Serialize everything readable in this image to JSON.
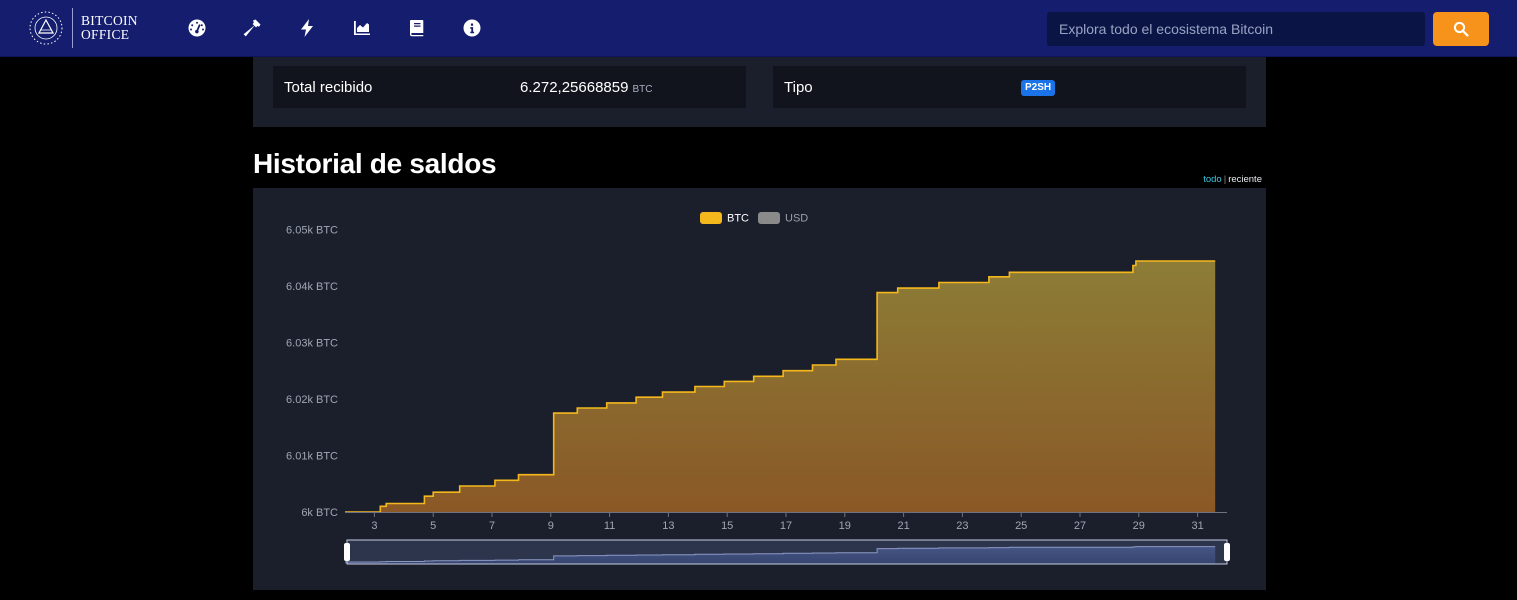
{
  "brand": {
    "line1": "BITCOIN",
    "line2": "OFFICE"
  },
  "nav": {
    "icons": [
      "dashboard-icon",
      "hammer-icon",
      "lightning-icon",
      "chart-icon",
      "book-icon",
      "info-icon"
    ]
  },
  "search": {
    "placeholder": "Explora todo el ecosistema Bitcoin"
  },
  "address_info": {
    "total_received_label": "Total recibido",
    "total_received_value": "6.272,25668859",
    "total_received_unit": "BTC",
    "type_label": "Tipo",
    "type_value": "P2SH"
  },
  "balance_history": {
    "title": "Historial de saldos",
    "range_all": "todo",
    "range_separator": "|",
    "range_recent": "reciente"
  },
  "colors": {
    "navbar": "#141d6e",
    "accent": "#f7931a",
    "panel": "#1b1f2c",
    "btc_line": "#f5b81c",
    "badge": "#1a73e8"
  },
  "chart_data": {
    "type": "area",
    "legend": [
      {
        "name": "BTC",
        "color": "#f5b81c",
        "active": true
      },
      {
        "name": "USD",
        "color": "#8a8a8a",
        "active": false
      }
    ],
    "legend_position": "top-center",
    "y_ticks": [
      {
        "value": 6000,
        "label": "6k BTC"
      },
      {
        "value": 6010,
        "label": "6.01k BTC"
      },
      {
        "value": 6020,
        "label": "6.02k BTC"
      },
      {
        "value": 6030,
        "label": "6.03k BTC"
      },
      {
        "value": 6040,
        "label": "6.04k BTC"
      },
      {
        "value": 6050,
        "label": "6.05k BTC"
      }
    ],
    "x_ticks": [
      3,
      5,
      7,
      9,
      11,
      13,
      15,
      17,
      19,
      21,
      23,
      25,
      27,
      29,
      31
    ],
    "xlim": [
      2,
      32
    ],
    "ylim": [
      6000,
      6052
    ],
    "grid": false,
    "step": true,
    "series": [
      {
        "name": "BTC",
        "points": [
          [
            2.0,
            6000.0
          ],
          [
            3.2,
            6000.0
          ],
          [
            3.2,
            6001.0
          ],
          [
            3.4,
            6001.0
          ],
          [
            3.4,
            6001.5
          ],
          [
            4.7,
            6001.5
          ],
          [
            4.7,
            6002.8
          ],
          [
            5.0,
            6002.8
          ],
          [
            5.0,
            6003.5
          ],
          [
            5.9,
            6003.5
          ],
          [
            5.9,
            6004.6
          ],
          [
            7.1,
            6004.6
          ],
          [
            7.1,
            6005.6
          ],
          [
            7.9,
            6005.6
          ],
          [
            7.9,
            6006.6
          ],
          [
            9.1,
            6006.6
          ],
          [
            9.1,
            6017.5
          ],
          [
            9.9,
            6017.5
          ],
          [
            9.9,
            6018.4
          ],
          [
            10.9,
            6018.4
          ],
          [
            10.9,
            6019.3
          ],
          [
            11.9,
            6019.3
          ],
          [
            11.9,
            6020.3
          ],
          [
            12.8,
            6020.3
          ],
          [
            12.8,
            6021.2
          ],
          [
            13.9,
            6021.2
          ],
          [
            13.9,
            6022.2
          ],
          [
            14.9,
            6022.2
          ],
          [
            14.9,
            6023.1
          ],
          [
            15.9,
            6023.1
          ],
          [
            15.9,
            6024.0
          ],
          [
            16.9,
            6024.0
          ],
          [
            16.9,
            6025.0
          ],
          [
            17.9,
            6025.0
          ],
          [
            17.9,
            6026.0
          ],
          [
            18.7,
            6026.0
          ],
          [
            18.7,
            6027.0
          ],
          [
            20.1,
            6027.0
          ],
          [
            20.1,
            6038.8
          ],
          [
            20.8,
            6038.8
          ],
          [
            20.8,
            6039.6
          ],
          [
            22.2,
            6039.6
          ],
          [
            22.2,
            6040.6
          ],
          [
            23.9,
            6040.6
          ],
          [
            23.9,
            6041.6
          ],
          [
            24.6,
            6041.6
          ],
          [
            24.6,
            6042.4
          ],
          [
            28.8,
            6042.4
          ],
          [
            28.8,
            6043.6
          ],
          [
            28.9,
            6043.6
          ],
          [
            28.9,
            6044.4
          ],
          [
            31.6,
            6044.4
          ]
        ]
      }
    ]
  }
}
